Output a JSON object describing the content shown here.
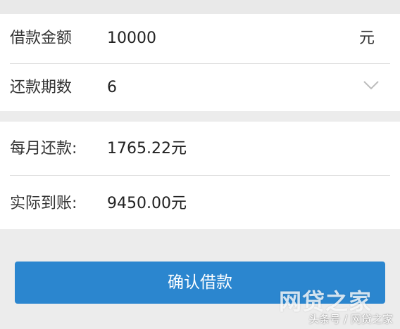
{
  "loan_form": {
    "amount": {
      "label": "借款金额",
      "value": "10000",
      "unit": "元"
    },
    "term": {
      "label": "还款期数",
      "value": "6",
      "dropdown_icon": "chevron-down-icon"
    }
  },
  "summary": {
    "monthly_repayment": {
      "label": "每月还款:",
      "value": "1765.22元"
    },
    "actual_received": {
      "label": "实际到账:",
      "value": "9450.00元"
    }
  },
  "confirm_button": {
    "label": "确认借款"
  },
  "watermark": {
    "logo": "网贷之家",
    "text": "头条号 / 网贷之家"
  },
  "colors": {
    "accent": "#2b86cf",
    "page_background": "#ececec",
    "card_background": "#ffffff"
  }
}
